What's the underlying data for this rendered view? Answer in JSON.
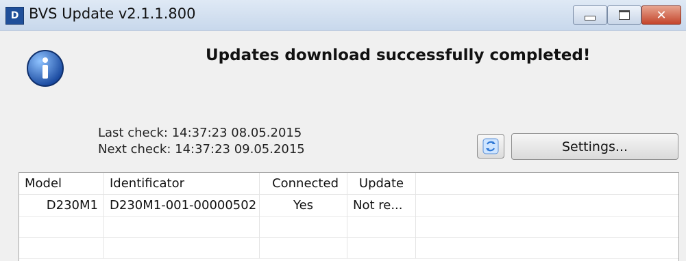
{
  "window": {
    "title": "BVS Update v2.1.1.800",
    "icon": "app-logo-icon",
    "colors": {
      "titlebar": "#c8d8ec",
      "close_button": "#c4452c"
    }
  },
  "message": {
    "icon": "info-icon",
    "text": "Updates download successfully completed!"
  },
  "status": {
    "last_check": "Last check: 14:37:23 08.05.2015",
    "next_check": "Next check: 14:37:23 09.05.2015"
  },
  "actions": {
    "refresh_icon": "refresh-icon",
    "settings_label": "Settings..."
  },
  "table": {
    "headers": [
      "Model",
      "Identificator",
      "Connected",
      "Update",
      ""
    ],
    "rows": [
      [
        "D230M1",
        "D230M1-001-00000502",
        "Yes",
        "Not re...",
        ""
      ],
      [
        "",
        "",
        "",
        "",
        ""
      ],
      [
        "",
        "",
        "",
        "",
        ""
      ]
    ]
  }
}
